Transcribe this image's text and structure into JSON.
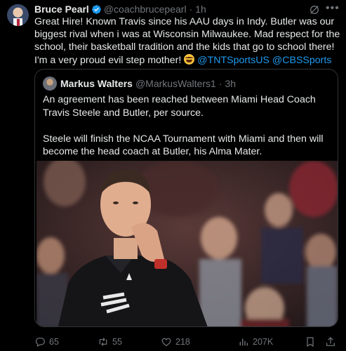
{
  "tweet": {
    "author_name": "Bruce Pearl",
    "author_handle": "@coachbrucepearl",
    "separator": "·",
    "time": "1h",
    "text_main": "Great Hire! Known Travis since his AAU days in Indy. Butler was our biggest rival when i was at Wisconsin Milwaukee. Mad respect for the school, their basketball tradition and the kids that go to school there! I'm a very proud evil step mother! ",
    "emoji_name": "laughing-face-emoji",
    "mention_1": "@TNTSportsUS",
    "mention_2": "@CBSSports"
  },
  "quoted": {
    "author_name": "Markus Walters",
    "author_handle": "@MarkusWalters1",
    "separator": "·",
    "time": "3h",
    "paragraph_1": "An agreement has been reached between Miami Head Coach Travis Steele and Butler, per source.",
    "paragraph_2": "Steele will finish the NCAA Tournament with Miami and then will become the head coach at Butler, his Alma Mater."
  },
  "actions": {
    "replies": "65",
    "reposts": "55",
    "likes": "218",
    "views": "207K"
  },
  "icons": {
    "verified": "verified-badge-icon",
    "grok": "grok-icon",
    "more": "more-options-icon",
    "reply": "reply-icon",
    "repost": "repost-icon",
    "like": "heart-icon",
    "views": "views-chart-icon",
    "bookmark": "bookmark-icon",
    "share": "share-icon"
  },
  "colors": {
    "background": "#000000",
    "text": "#e7e9ea",
    "secondary": "#71767b",
    "link": "#1d9bf0",
    "border": "#2f3336"
  }
}
